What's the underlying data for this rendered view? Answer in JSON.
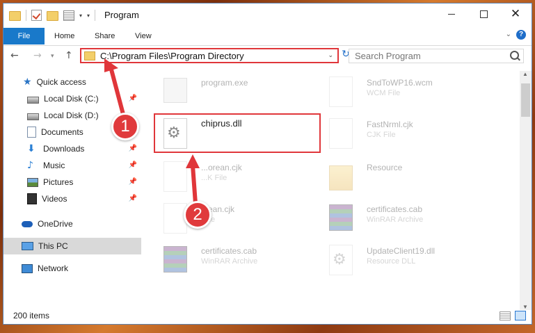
{
  "window": {
    "title": "Program",
    "close_glyph": "✕"
  },
  "ribbon": {
    "tabs": [
      "File",
      "Home",
      "Share",
      "View"
    ],
    "help_glyph": "?"
  },
  "nav": {
    "address": "C:\\Program Files\\Program Directory",
    "search_placeholder": "Search Program"
  },
  "sidebar": {
    "items": [
      {
        "label": "Quick access",
        "icon": "star-icon",
        "pinned": false
      },
      {
        "label": "Local Disk (C:)",
        "icon": "drive-icon",
        "pinned": true
      },
      {
        "label": "Local Disk (D:)",
        "icon": "drive-icon",
        "pinned": false
      },
      {
        "label": "Documents",
        "icon": "documents-icon",
        "pinned": true
      },
      {
        "label": "Downloads",
        "icon": "downloads-icon",
        "pinned": true
      },
      {
        "label": "Music",
        "icon": "music-icon",
        "pinned": true
      },
      {
        "label": "Pictures",
        "icon": "pictures-icon",
        "pinned": true
      },
      {
        "label": "Videos",
        "icon": "videos-icon",
        "pinned": true
      },
      {
        "label": "OneDrive",
        "icon": "onedrive-icon",
        "pinned": false
      },
      {
        "label": "This PC",
        "icon": "this-pc-icon",
        "pinned": false,
        "selected": true
      },
      {
        "label": "Network",
        "icon": "network-icon",
        "pinned": false
      }
    ]
  },
  "files": {
    "items": [
      {
        "name": "program.exe",
        "type": "",
        "icon": "exe-icon"
      },
      {
        "name": "SndToWP16.wcm",
        "type": "WCM File",
        "icon": "file-icon"
      },
      {
        "name": "chiprus.dll",
        "type": "",
        "icon": "dll-gear-icon"
      },
      {
        "name": "FastNrml.cjk",
        "type": "CJK File",
        "icon": "file-icon"
      },
      {
        "name": "...orean.cjk",
        "type": "...K File",
        "icon": "file-icon"
      },
      {
        "name": "Resource",
        "type": "",
        "icon": "folder-icon"
      },
      {
        "name": "...ean.cjk",
        "type": "...ile",
        "icon": "file-icon"
      },
      {
        "name": "certificates.cab",
        "type": "WinRAR Archive",
        "icon": "rar-icon"
      },
      {
        "name": "certificates.cab",
        "type": "WinRAR Archive",
        "icon": "rar-icon"
      },
      {
        "name": "UpdateClient19.dll",
        "type": "Resource DLL",
        "icon": "dll-gear-icon"
      }
    ]
  },
  "status": {
    "count": "200 items"
  },
  "annotations": {
    "step1": "1",
    "step2": "2",
    "color": "#e0363a"
  }
}
